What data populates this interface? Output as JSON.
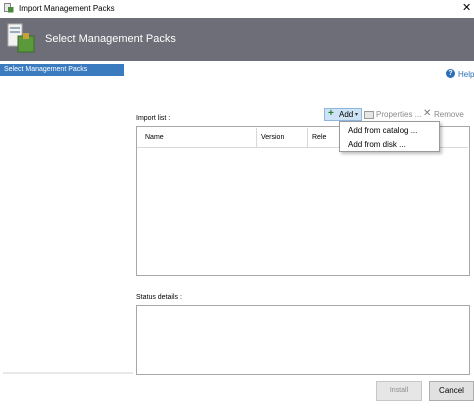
{
  "window": {
    "title": "Import Management Packs",
    "close_glyph": "✕",
    "icon": "management-pack-icon"
  },
  "banner": {
    "title": "Select Management Packs",
    "icon": "management-pack-wizard-icon",
    "bg_color": "#6e6e78"
  },
  "nav": {
    "items": [
      {
        "label": "Select Management Packs",
        "selected": true
      }
    ],
    "accent_color": "#3a7bc0"
  },
  "help": {
    "label": "Help",
    "icon": "help-icon"
  },
  "import_list": {
    "label": "Import list :",
    "toolbar": {
      "add_label": "Add",
      "add_caret": "▾",
      "add_icon": "plus-icon",
      "properties_label": "Properties ...",
      "properties_icon": "properties-icon",
      "remove_label": "Remove",
      "remove_icon": "remove-x-icon"
    },
    "columns": [
      "Name",
      "Version",
      "Rele"
    ]
  },
  "add_menu": {
    "items": [
      "Add from catalog ...",
      "Add from disk ..."
    ]
  },
  "status": {
    "label": "Status details :"
  },
  "buttons": {
    "install_label": "Install",
    "cancel_label": "Cancel"
  }
}
